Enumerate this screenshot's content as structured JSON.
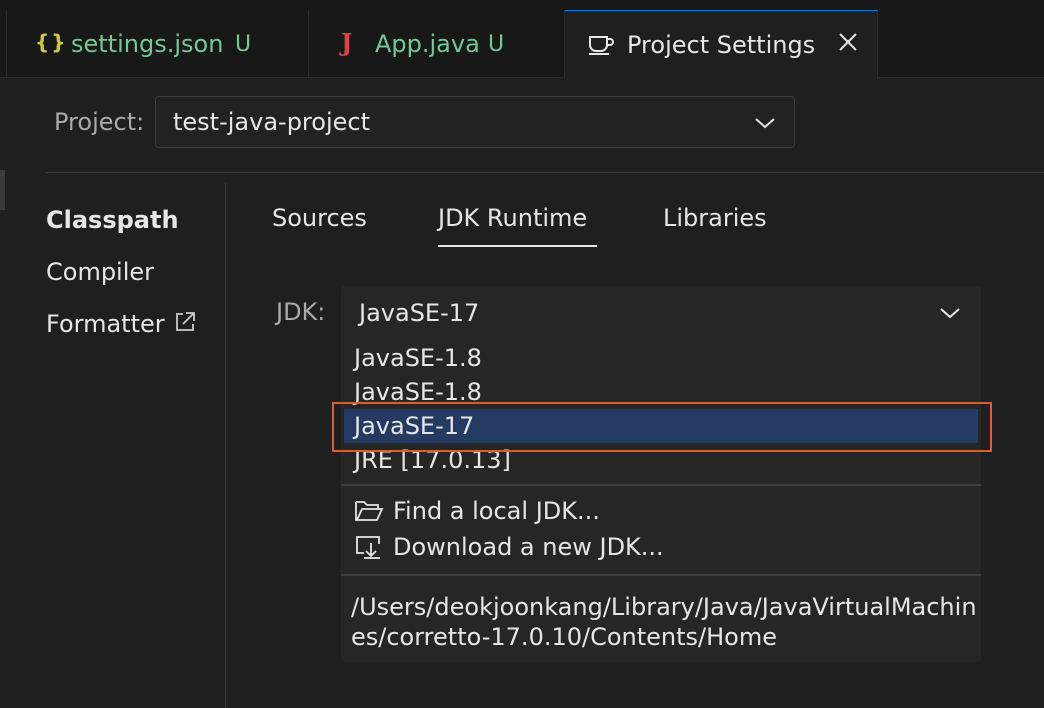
{
  "tabs": [
    {
      "icon": "{}",
      "label": "settings.json",
      "badge": "U"
    },
    {
      "icon": "J",
      "label": "App.java",
      "badge": "U"
    },
    {
      "label": "Project Settings",
      "active": true
    }
  ],
  "project": {
    "label": "Project:",
    "value": "test-java-project"
  },
  "nav": {
    "classpath": "Classpath",
    "compiler": "Compiler",
    "formatter": "Formatter"
  },
  "subtabs": {
    "sources": "Sources",
    "jdk_runtime": "JDK Runtime",
    "libraries": "Libraries",
    "active": "JDK Runtime"
  },
  "jdk": {
    "label": "JDK:",
    "selected": "JavaSE-17",
    "options": [
      "JavaSE-1.8",
      "JavaSE-1.8",
      "JavaSE-17",
      "JRE [17.0.13]"
    ],
    "highlighted_option": "JavaSE-17",
    "find_local": "Find a local JDK...",
    "download_new": "Download a new JDK...",
    "path": "/Users/deokjoonkang/Library/Java/JavaVirtualMachines/corretto-17.0.10/Contents/Home"
  },
  "colors": {
    "accent": "#0078d4",
    "selection": "#243a62",
    "highlight_border": "#e05a33",
    "untracked": "#73c991"
  }
}
